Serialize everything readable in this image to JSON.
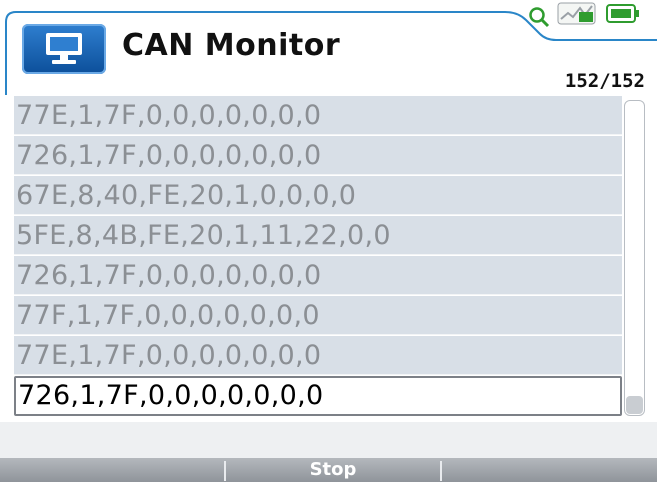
{
  "header": {
    "title": "CAN Monitor",
    "counter": "152/152",
    "app_icon": "monitor-icon",
    "status_icons": [
      "search-icon",
      "signal-icon",
      "battery-icon"
    ],
    "colors": {
      "accent": "#1e6fc0",
      "status_green": "#2f9c2f",
      "line": "#2a86c8"
    }
  },
  "messages": [
    "77E,1,7F,0,0,0,0,0,0,0",
    "726,1,7F,0,0,0,0,0,0,0",
    "67E,8,40,FE,20,1,0,0,0,0",
    "5FE,8,4B,FE,20,1,11,22,0,0",
    "726,1,7F,0,0,0,0,0,0,0",
    "77F,1,7F,0,0,0,0,0,0,0",
    "77E,1,7F,0,0,0,0,0,0,0",
    "726,1,7F,0,0,0,0,0,0,0"
  ],
  "selected_index": 7,
  "softkeys": {
    "left": "",
    "center": "Stop",
    "right": ""
  }
}
